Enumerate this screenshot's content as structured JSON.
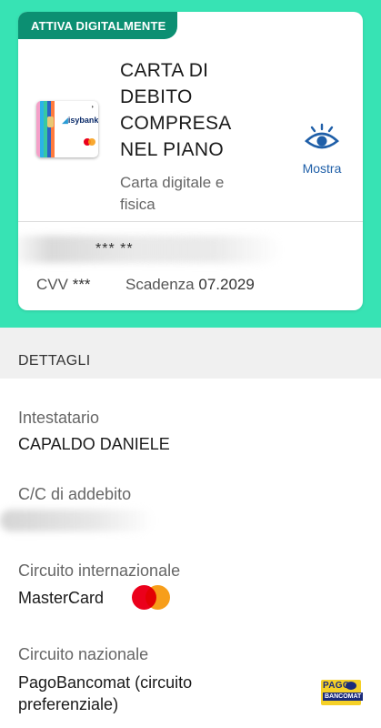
{
  "card": {
    "badge": "ATTIVA DIGITALMENTE",
    "title": "CARTA DI DEBITO COMPRESA NEL PIANO",
    "subtitle": "Carta digitale e fisica",
    "show_label": "Mostra",
    "number": "*** **",
    "cvv_label": "CVV",
    "cvv_value": "***",
    "expiry_label": "Scadenza",
    "expiry_value": "07.2029",
    "card_image_brand": "isybank"
  },
  "details": {
    "header": "DETTAGLI",
    "holder_label": "Intestatario",
    "holder_value": "CAPALDO DANIELE",
    "account_label": "C/C di addebito",
    "intl_circuit_label": "Circuito internazionale",
    "intl_circuit_value": "MasterCard",
    "national_circuit_label": "Circuito nazionale",
    "national_circuit_value": "PagoBancomat (circuito preferenziale)",
    "pagobancomat_logo_top": "PAGO",
    "pagobancomat_logo_bottom": "BANCOMAT"
  },
  "colors": {
    "hero_bg": "#37e3b4",
    "badge_bg": "#0c8f72",
    "link_blue": "#1f5fa8"
  },
  "icons": [
    "eye-icon",
    "mastercard-logo-icon",
    "pagobancomat-logo-icon"
  ]
}
